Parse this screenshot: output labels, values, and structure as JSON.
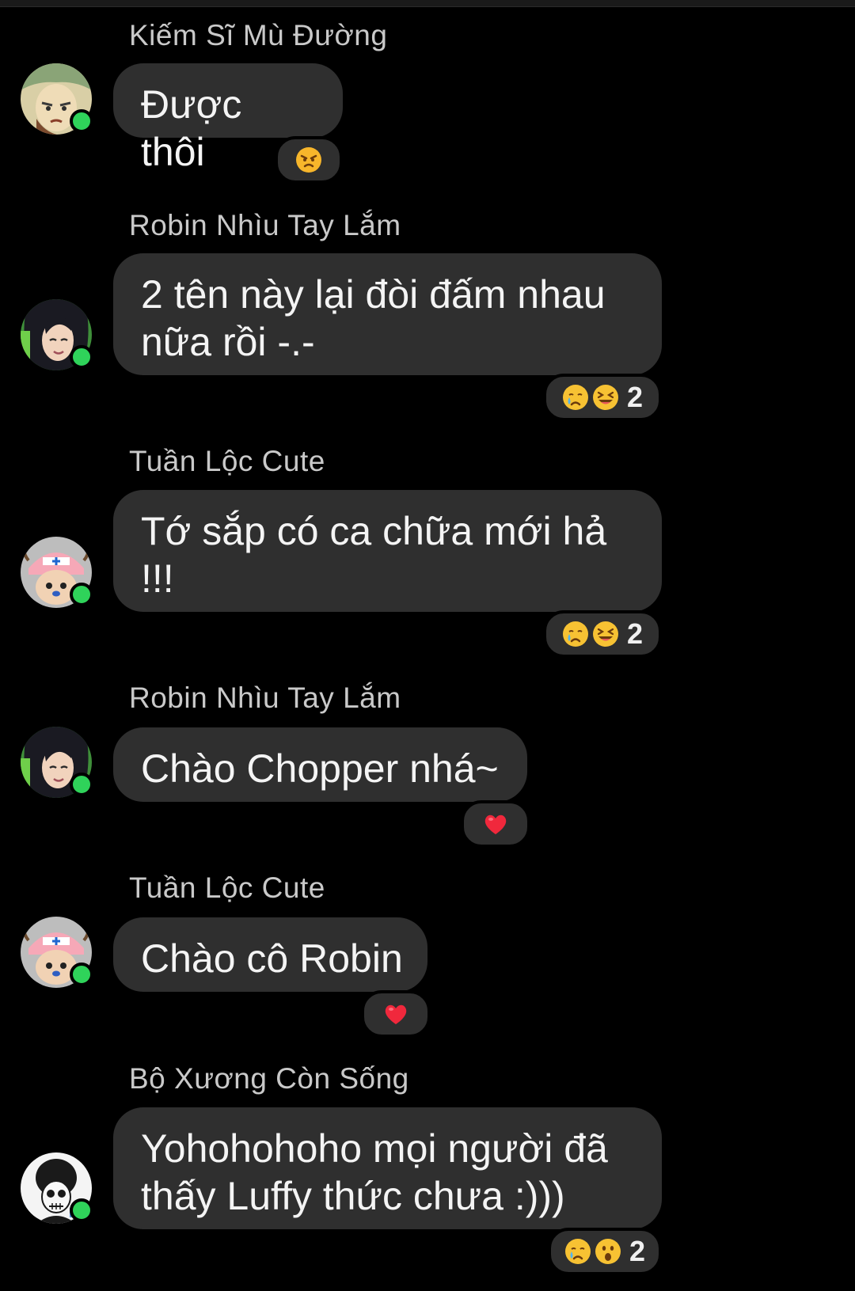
{
  "colors": {
    "background": "#000000",
    "bubble": "#2f2f2f",
    "online": "#2fd35a",
    "sender_text": "#c9c9c9"
  },
  "messages": [
    {
      "sender": "Kiếm Sĩ Mù Đường",
      "text": "Được thôi",
      "avatar": "zoro-avatar",
      "reactions": [
        "angry-emoji"
      ],
      "reaction_count": ""
    },
    {
      "sender": "Robin Nhìu Tay Lắm",
      "text": "2 tên này lại đòi đấm nhau nữa rồi -.-",
      "avatar": "robin-avatar",
      "reactions": [
        "crying-emoji",
        "laughing-emoji"
      ],
      "reaction_count": "2"
    },
    {
      "sender": "Tuần Lộc Cute",
      "text": "Tớ sắp có ca chữa mới hả !!!",
      "avatar": "chopper-avatar",
      "reactions": [
        "crying-emoji",
        "laughing-emoji"
      ],
      "reaction_count": "2"
    },
    {
      "sender": "Robin Nhìu Tay Lắm",
      "text": "Chào Chopper nhá~",
      "avatar": "robin-avatar",
      "reactions": [
        "heart-emoji"
      ],
      "reaction_count": ""
    },
    {
      "sender": "Tuần Lộc Cute",
      "text": "Chào cô Robin",
      "avatar": "chopper-avatar",
      "reactions": [
        "heart-emoji"
      ],
      "reaction_count": ""
    },
    {
      "sender": "Bộ Xương Còn Sống",
      "text": "Yohohohoho mọi người đã thấy Luffy thức chưa :)))",
      "avatar": "brook-avatar",
      "reactions": [
        "crying-emoji",
        "surprised-emoji"
      ],
      "reaction_count": "2"
    }
  ]
}
